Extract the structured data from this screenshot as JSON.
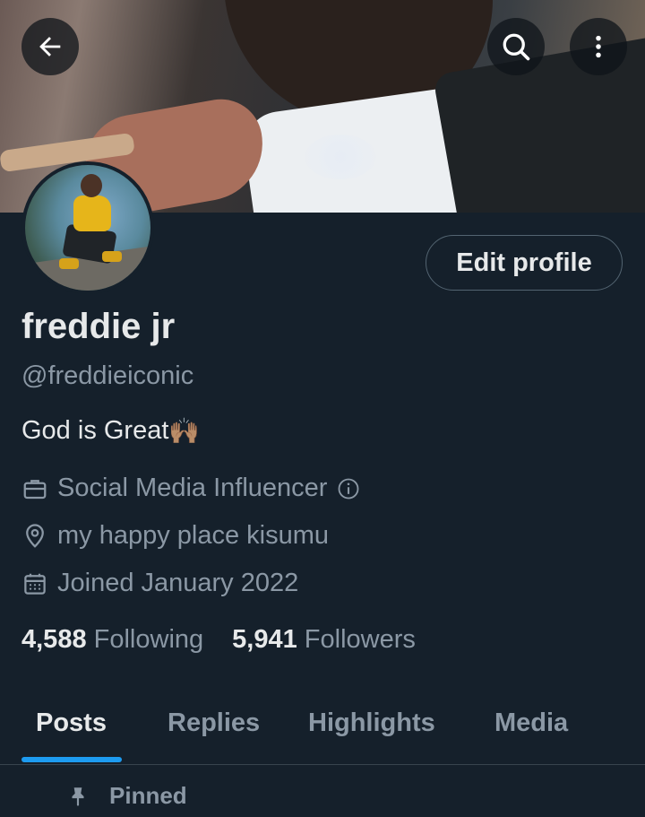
{
  "header": {
    "back_icon": "arrow-left-icon",
    "search_icon": "search-icon",
    "more_icon": "more-vertical-icon"
  },
  "profile": {
    "name": "freddie jr",
    "handle": "@freddieiconic",
    "bio": "God is Great",
    "bio_emoji": "🙌🏽",
    "edit_button": "Edit profile",
    "category": "Social Media Influencer",
    "location": "my happy place kisumu",
    "joined": "Joined January 2022"
  },
  "stats": {
    "following_count": "4,588",
    "following_label": "Following",
    "followers_count": "5,941",
    "followers_label": "Followers"
  },
  "tabs": [
    {
      "label": "Posts",
      "active": true
    },
    {
      "label": "Replies",
      "active": false
    },
    {
      "label": "Highlights",
      "active": false
    },
    {
      "label": "Media",
      "active": false
    }
  ],
  "feed": {
    "pinned_label": "Pinned"
  },
  "colors": {
    "background": "#15202b",
    "accent": "#1d9bf0",
    "muted_text": "#8b98a5",
    "border": "#536471"
  }
}
